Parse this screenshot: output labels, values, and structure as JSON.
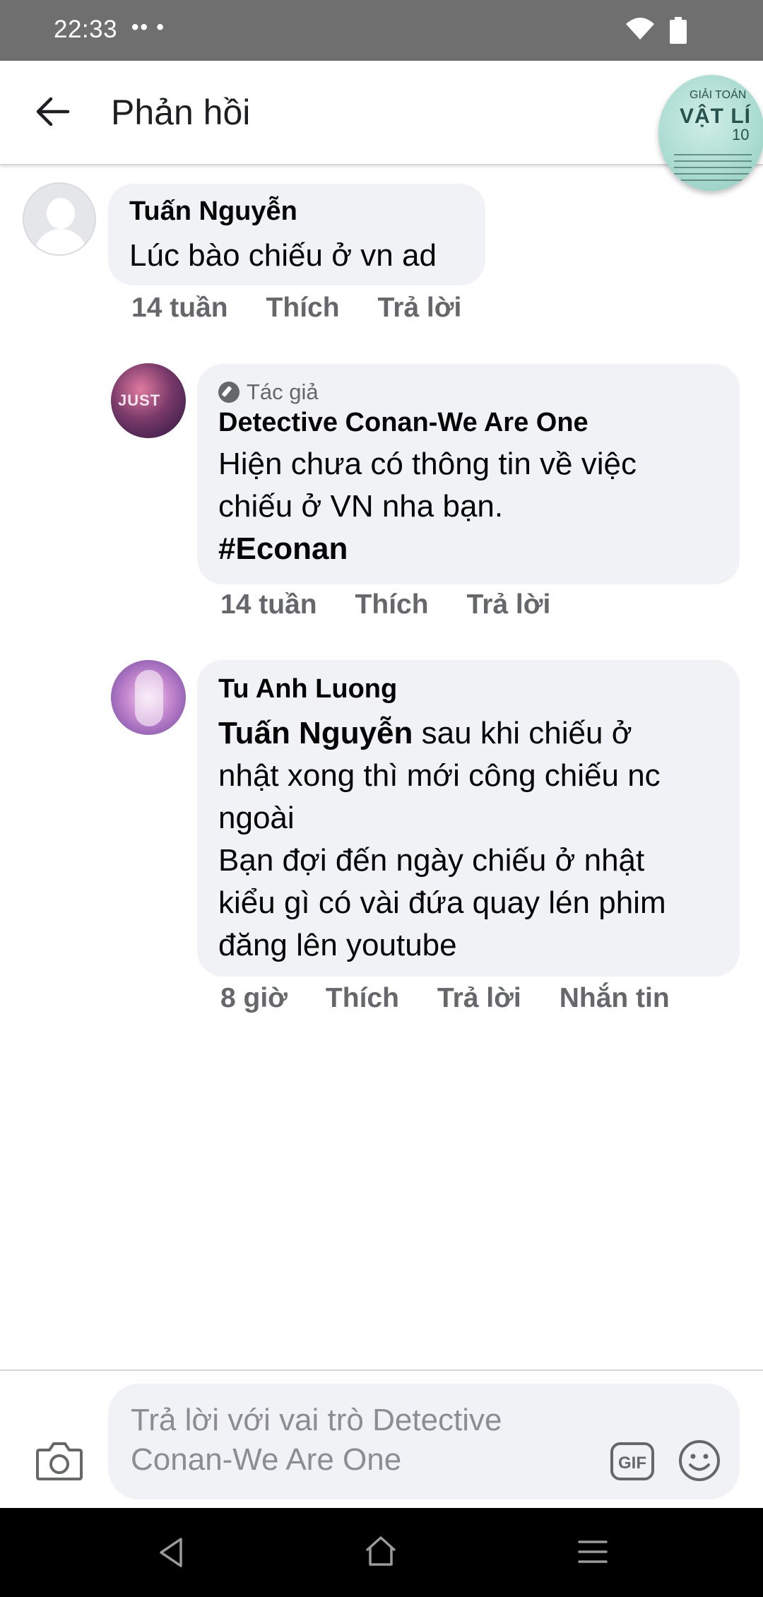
{
  "status_bar": {
    "time": "22:33",
    "indicators": "•• •"
  },
  "header": {
    "title": "Phản hồi",
    "chat_head": {
      "top_text": "GIẢI TOÁN",
      "main_text": "VẬT LÍ",
      "number_text": "10"
    }
  },
  "comments": [
    {
      "author": "Tuấn Nguyễn",
      "lines": [
        "Lúc bào chiếu ở vn ad"
      ],
      "time": "14 tuần",
      "like": "Thích",
      "reply": "Trả lời"
    },
    {
      "badge": "Tác giả",
      "author": "Detective Conan-We Are One",
      "avatar_text": "JUST",
      "lines": [
        "Hiện chưa có thông tin về việc",
        "chiếu ở VN nha bạn."
      ],
      "hashtag": "#Econan",
      "time": "14 tuần",
      "like": "Thích",
      "reply": "Trả lời"
    },
    {
      "author": "Tu Anh Luong",
      "mention": "Tuấn Nguyễn",
      "first_line_rest": " sau khi chiếu ở",
      "lines": [
        "nhật xong thì mới công chiếu nc",
        "ngoài",
        "Bạn đợi đến ngày chiếu ở nhật",
        "kiểu gì có vài đứa quay lén phim",
        "đăng lên youtube"
      ],
      "time": "8 giờ",
      "like": "Thích",
      "reply": "Trả lời",
      "message": "Nhắn tin"
    }
  ],
  "composer": {
    "placeholder_line1": "Trả lời với vai trò Detective",
    "placeholder_line2": "Conan-We Are One",
    "gif_label": "GIF"
  }
}
